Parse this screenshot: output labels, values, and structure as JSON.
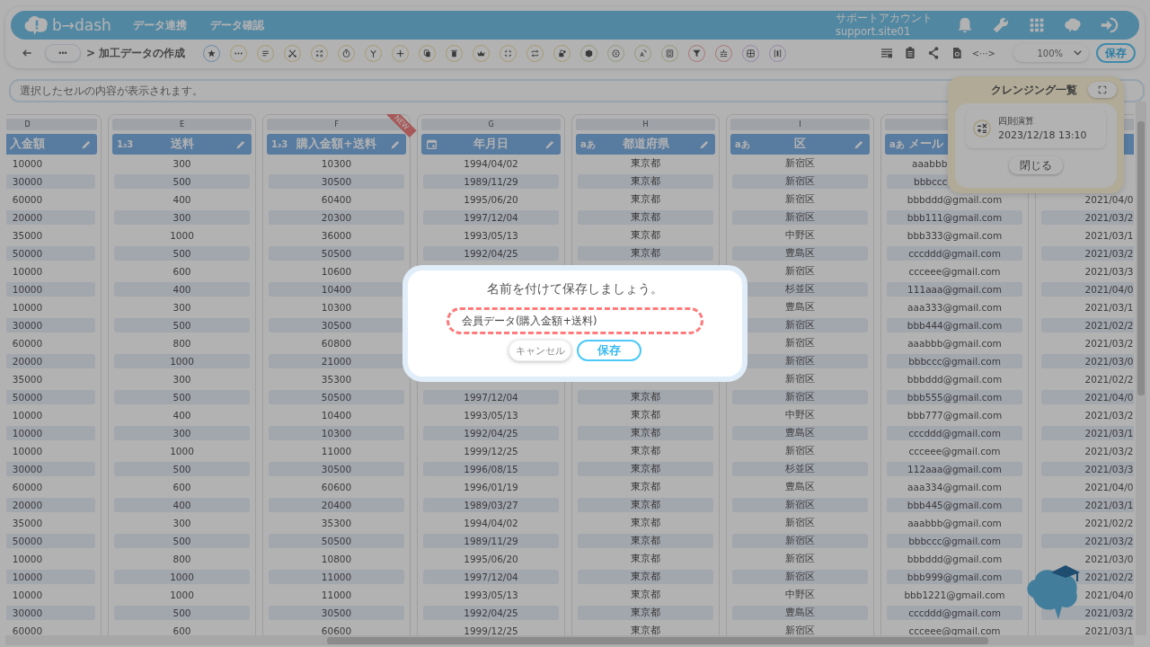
{
  "header": {
    "logo": "b→dash",
    "nav": [
      "データ連携",
      "データ確認"
    ],
    "account": {
      "name": "サポートアカウント",
      "id": "support.site01"
    }
  },
  "toolbar": {
    "breadcrumb_more": "•••",
    "breadcrumb": "> 加工データの作成",
    "code_label": "<···>",
    "zoom": "100%",
    "save": "保存"
  },
  "formula_bar": {
    "placeholder": "選択したセルの内容が表示されます。"
  },
  "table": {
    "columns": [
      {
        "letter": "D",
        "title": "入金額"
      },
      {
        "letter": "E",
        "title": "送料",
        "kind": "number",
        "type_mark": "1₂3"
      },
      {
        "letter": "F",
        "title": "購入金額+送料",
        "kind": "number",
        "type_mark": "1₂3",
        "badge": "NEW"
      },
      {
        "letter": "G",
        "title": "年月日",
        "kind": "date"
      },
      {
        "letter": "H",
        "title": "都道府県",
        "kind": "text",
        "type_mark": "aあ"
      },
      {
        "letter": "I",
        "title": "区",
        "kind": "text",
        "type_mark": "aあ"
      },
      {
        "title": "メール",
        "kind": "text",
        "type_mark": "aあ",
        "cut": true
      },
      {}
    ],
    "rows": [
      [
        "10000",
        "300",
        "10300",
        "1994/04/02",
        "東京都",
        "新宿区",
        {
          "text": "aaabbb",
          "cut": true
        },
        null
      ],
      [
        "30000",
        "500",
        "30500",
        "1989/11/29",
        "東京都",
        "新宿区",
        {
          "text": "bbbccc",
          "cut": true
        },
        null
      ],
      [
        "60000",
        "400",
        "60400",
        "1995/06/20",
        "東京都",
        "新宿区",
        "bbbddd@gmail.com",
        "2021/04/0"
      ],
      [
        "20000",
        "300",
        "20300",
        "1997/12/04",
        "東京都",
        "新宿区",
        "bbb111@gmail.com",
        "2021/03/2"
      ],
      [
        "35000",
        "1000",
        "36000",
        "1993/05/13",
        "東京都",
        "中野区",
        "bbb333@gmail.com",
        "2021/03/1"
      ],
      [
        "50000",
        "500",
        "50500",
        "1992/04/25",
        "東京都",
        "豊島区",
        "cccddd@gmail.com",
        "2021/03/2"
      ],
      [
        "10000",
        "600",
        "10600",
        null,
        null,
        "新宿区",
        "ccceee@gmail.com",
        "2021/03/3"
      ],
      [
        "10000",
        "400",
        "10400",
        null,
        null,
        "杉並区",
        "111aaa@gmail.com",
        "2021/04/0"
      ],
      [
        "10000",
        "300",
        "10300",
        null,
        null,
        "豊島区",
        "aaa333@gmail.com",
        "2021/03/1"
      ],
      [
        "30000",
        "500",
        "30500",
        null,
        null,
        "新宿区",
        "bbb444@gmail.com",
        "2021/02/2"
      ],
      [
        "60000",
        "800",
        "60800",
        null,
        null,
        "新宿区",
        "aaabbb@gmail.com",
        "2021/03/2"
      ],
      [
        "20000",
        "1000",
        "21000",
        null,
        null,
        "新宿区",
        "bbbccc@gmail.com",
        "2021/03/0"
      ],
      [
        "35000",
        "300",
        "35300",
        null,
        null,
        "新宿区",
        "bbbddd@gmail.com",
        "2021/02/2"
      ],
      [
        "50000",
        "500",
        "50500",
        "1997/12/04",
        "東京都",
        "新宿区",
        "bbb555@gmail.com",
        "2021/04/0"
      ],
      [
        "10000",
        "400",
        "10400",
        "1993/05/13",
        "東京都",
        "中野区",
        "bbb777@gmail.com",
        "2021/03/2"
      ],
      [
        "10000",
        "300",
        "10300",
        "1992/04/25",
        "東京都",
        "豊島区",
        "cccddd@gmail.com",
        "2021/03/1"
      ],
      [
        "10000",
        "1000",
        "11000",
        "1999/12/25",
        "東京都",
        "新宿区",
        "ccceee@gmail.com",
        "2021/03/2"
      ],
      [
        "30000",
        "500",
        "30500",
        "1996/08/15",
        "東京都",
        "杉並区",
        "112aaa@gmail.com",
        "2021/03/3"
      ],
      [
        "60000",
        "600",
        "60600",
        "1996/01/19",
        "東京都",
        "豊島区",
        "aaa334@gmail.com",
        "2021/04/0"
      ],
      [
        "20000",
        "400",
        "20400",
        "1989/03/27",
        "東京都",
        "新宿区",
        "bbb445@gmail.com",
        "2021/03/1"
      ],
      [
        "35000",
        "300",
        "35300",
        "1994/04/02",
        "東京都",
        "新宿区",
        "aaabbb@gmail.com",
        "2021/02/2"
      ],
      [
        "50000",
        "500",
        "50500",
        "1989/11/29",
        "東京都",
        "新宿区",
        "bbbccc@gmail.com",
        "2021/03/2"
      ],
      [
        "10000",
        "800",
        "10800",
        "1995/06/20",
        "東京都",
        "新宿区",
        "bbbddd@gmail.com",
        "2021/03/0"
      ],
      [
        "10000",
        "1000",
        "11000",
        "1997/12/04",
        "東京都",
        "新宿区",
        "bbb999@gmail.com",
        "2021/02/2"
      ],
      [
        "10000",
        "1000",
        "11000",
        "1993/05/13",
        "東京都",
        "中野区",
        "bbb1221@gmail.com",
        "2021/04/0"
      ],
      [
        "30000",
        "500",
        "30500",
        "1992/04/25",
        "東京都",
        "豊島区",
        "cccddd@gmail.com",
        "2021/03/2"
      ],
      [
        "60000",
        "600",
        "60600",
        "1999/12/25",
        "東京都",
        "新宿区",
        "ccceee@gmail.com",
        "2021/03/1"
      ]
    ]
  },
  "cleansing_panel": {
    "title": "クレンジング一覧",
    "items": [
      {
        "name": "四則演算",
        "time": "2023/12/18 13:10"
      }
    ],
    "close": "閉じる"
  },
  "dialog": {
    "title": "名前を付けて保存しましょう。",
    "value": "会員データ(購入金額+送料)",
    "cancel": "キャンセル",
    "save": "保存"
  }
}
